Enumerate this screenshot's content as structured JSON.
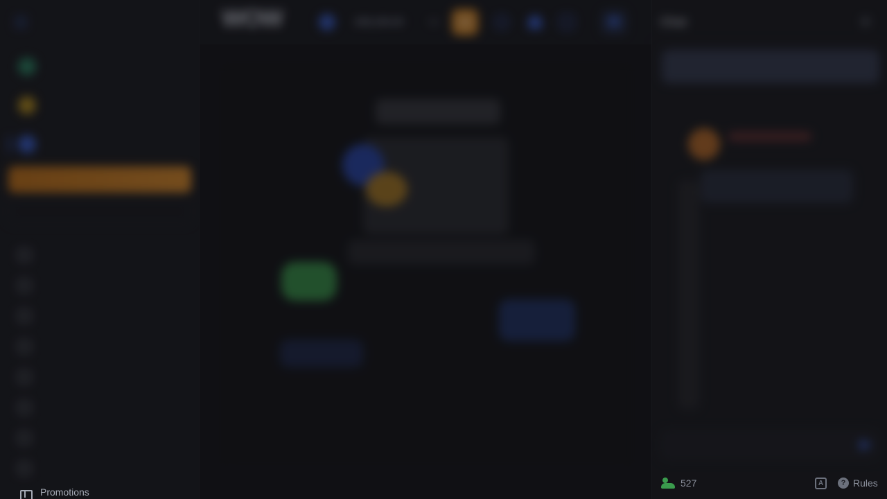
{
  "header": {
    "logo_text": "WOW",
    "balance": "208,190.00"
  },
  "sidebar": {
    "promotions_label": "Promotions"
  },
  "chat": {
    "title": "Chat",
    "online_count": "527",
    "rules_label": "Rules"
  },
  "colors": {
    "accent_blue": "#3d66e0",
    "accent_orange": "#f39a2b",
    "online_green": "#3a9b4d",
    "background": "#17181c"
  }
}
